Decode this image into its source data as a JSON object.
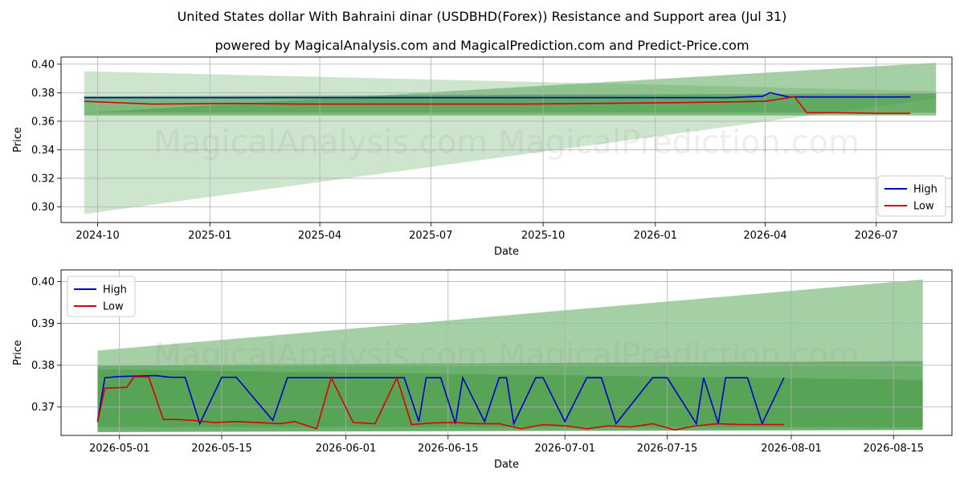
{
  "title_line1": "United States dollar With Bahraini dinar (USDBHD(Forex)) Resistance and Support area (Jul 31)",
  "title_line2": "powered by MagicalAnalysis.com and MagicalPrediction.com and Predict-Price.com",
  "watermark": "MagicalAnalysis.com    MagicalPrediction.com",
  "colors": {
    "high": "#0000cc",
    "low": "#dd0000",
    "band": "#4a9e4a"
  },
  "chart_data": [
    {
      "type": "line",
      "xlabel": "Date",
      "ylabel": "Price",
      "xlim": [
        "2024-09-01",
        "2026-09-01"
      ],
      "ylim": [
        0.289,
        0.405
      ],
      "legend": "bottom-right",
      "grid": true,
      "x_ticks": [
        "2024-10",
        "2025-01",
        "2025-04",
        "2025-07",
        "2025-10",
        "2026-01",
        "2026-04",
        "2026-07"
      ],
      "y_ticks": [
        "0.30",
        "0.32",
        "0.34",
        "0.36",
        "0.38",
        "0.40"
      ],
      "series": [
        {
          "name": "High",
          "x": [
            "2024-09-20",
            "2024-11-15",
            "2025-01-20",
            "2025-03-15",
            "2025-05-10",
            "2025-07-15",
            "2025-09-15",
            "2025-11-15",
            "2026-01-15",
            "2026-03-01",
            "2026-03-30",
            "2026-04-05",
            "2026-04-20",
            "2026-05-15",
            "2026-06-15",
            "2026-07-15",
            "2026-07-29"
          ],
          "y": [
            0.3765,
            0.3765,
            0.3765,
            0.3765,
            0.3765,
            0.3765,
            0.3765,
            0.3765,
            0.3765,
            0.3765,
            0.3775,
            0.38,
            0.377,
            0.377,
            0.377,
            0.377,
            0.377
          ]
        },
        {
          "name": "Low",
          "x": [
            "2024-09-20",
            "2024-11-15",
            "2025-01-20",
            "2025-03-15",
            "2025-05-10",
            "2025-07-15",
            "2025-09-15",
            "2025-11-15",
            "2026-01-15",
            "2026-03-01",
            "2026-04-01",
            "2026-04-25",
            "2026-05-05",
            "2026-06-01",
            "2026-07-01",
            "2026-07-29"
          ],
          "y": [
            0.374,
            0.372,
            0.3725,
            0.372,
            0.372,
            0.372,
            0.372,
            0.3725,
            0.373,
            0.3735,
            0.374,
            0.3772,
            0.366,
            0.366,
            0.3655,
            0.3655
          ]
        }
      ],
      "bands": [
        {
          "x": [
            "2024-09-20",
            "2026-08-19"
          ],
          "upper": [
            0.395,
            0.381
          ],
          "lower": [
            0.295,
            0.376
          ]
        },
        {
          "x": [
            "2024-09-20",
            "2026-08-19"
          ],
          "upper": [
            0.366,
            0.401
          ],
          "lower": [
            0.366,
            0.366
          ]
        },
        {
          "x": [
            "2024-09-20",
            "2026-08-19"
          ],
          "upper": [
            0.3775,
            0.3795
          ],
          "lower": [
            0.364,
            0.364
          ]
        }
      ]
    },
    {
      "type": "line",
      "xlabel": "Date",
      "ylabel": "Price",
      "xlim": [
        "2026-04-23",
        "2026-08-23"
      ],
      "ylim": [
        0.3632,
        0.4028
      ],
      "legend": "top-left",
      "grid": true,
      "x_ticks": [
        "2026-05-01",
        "2026-05-15",
        "2026-06-01",
        "2026-06-15",
        "2026-07-01",
        "2026-07-15",
        "2026-08-01",
        "2026-08-15"
      ],
      "y_ticks": [
        "0.37",
        "0.38",
        "0.39",
        "0.40"
      ],
      "series": [
        {
          "name": "High",
          "x": [
            "2026-04-28",
            "2026-04-29",
            "2026-05-01",
            "2026-05-06",
            "2026-05-08",
            "2026-05-10",
            "2026-05-12",
            "2026-05-15",
            "2026-05-17",
            "2026-05-22",
            "2026-05-24",
            "2026-05-26",
            "2026-06-01",
            "2026-06-06",
            "2026-06-09",
            "2026-06-11",
            "2026-06-12",
            "2026-06-14",
            "2026-06-16",
            "2026-06-17",
            "2026-06-20",
            "2026-06-22",
            "2026-06-23",
            "2026-06-24",
            "2026-06-27",
            "2026-06-28",
            "2026-07-01",
            "2026-07-04",
            "2026-07-06",
            "2026-07-08",
            "2026-07-13",
            "2026-07-15",
            "2026-07-19",
            "2026-07-20",
            "2026-07-22",
            "2026-07-23",
            "2026-07-26",
            "2026-07-28",
            "2026-07-31"
          ],
          "y": [
            0.3666,
            0.377,
            0.3773,
            0.3775,
            0.3771,
            0.3771,
            0.366,
            0.3771,
            0.3771,
            0.3668,
            0.377,
            0.377,
            0.377,
            0.377,
            0.377,
            0.3665,
            0.377,
            0.377,
            0.366,
            0.377,
            0.3665,
            0.377,
            0.377,
            0.366,
            0.377,
            0.377,
            0.3665,
            0.377,
            0.377,
            0.366,
            0.377,
            0.377,
            0.366,
            0.377,
            0.366,
            0.377,
            0.377,
            0.366,
            0.377
          ]
        },
        {
          "name": "Low",
          "x": [
            "2026-04-28",
            "2026-04-29",
            "2026-05-02",
            "2026-05-03",
            "2026-05-05",
            "2026-05-07",
            "2026-05-09",
            "2026-05-11",
            "2026-05-14",
            "2026-05-17",
            "2026-05-20",
            "2026-05-23",
            "2026-05-25",
            "2026-05-28",
            "2026-05-30",
            "2026-06-02",
            "2026-06-05",
            "2026-06-08",
            "2026-06-10",
            "2026-06-13",
            "2026-06-16",
            "2026-06-19",
            "2026-06-22",
            "2026-06-25",
            "2026-06-28",
            "2026-07-01",
            "2026-07-04",
            "2026-07-07",
            "2026-07-10",
            "2026-07-13",
            "2026-07-16",
            "2026-07-19",
            "2026-07-22",
            "2026-07-25",
            "2026-07-28",
            "2026-07-31"
          ],
          "y": [
            0.3664,
            0.3745,
            0.3747,
            0.3772,
            0.3772,
            0.367,
            0.367,
            0.3668,
            0.3663,
            0.3665,
            0.3663,
            0.366,
            0.3665,
            0.3648,
            0.377,
            0.3663,
            0.366,
            0.377,
            0.3658,
            0.3662,
            0.3663,
            0.366,
            0.366,
            0.3648,
            0.3658,
            0.3655,
            0.3648,
            0.3655,
            0.3652,
            0.366,
            0.3645,
            0.3655,
            0.366,
            0.3658,
            0.3658,
            0.3658
          ]
        }
      ],
      "bands": [
        {
          "x": [
            "2026-04-28",
            "2026-08-19"
          ],
          "upper": [
            0.3835,
            0.4005
          ],
          "lower": [
            0.38,
            0.381
          ]
        },
        {
          "x": [
            "2026-04-28",
            "2026-08-19"
          ],
          "upper": [
            0.38,
            0.381
          ],
          "lower": [
            0.364,
            0.3645
          ]
        },
        {
          "x": [
            "2026-04-28",
            "2026-08-19"
          ],
          "upper": [
            0.379,
            0.3765
          ],
          "lower": [
            0.3652,
            0.3652
          ]
        }
      ]
    }
  ]
}
